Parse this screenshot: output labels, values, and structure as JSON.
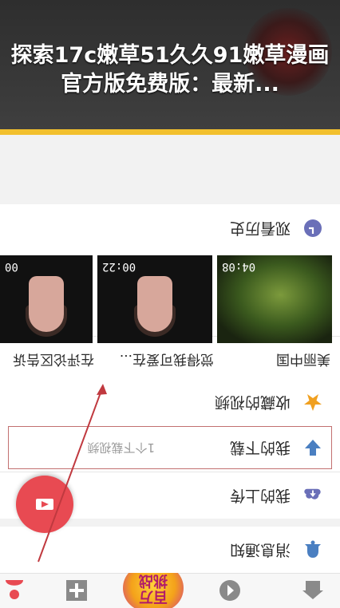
{
  "banner": {
    "title": "探索17c嫩草51久久91嫩草漫画官方版免费版：最新..."
  },
  "app": {
    "rows": {
      "messages": "消息通知",
      "uploads": "我的上传",
      "favorites": "收藏的视频",
      "downloads": "我的下载",
      "downloads_hint": "1个下载视频",
      "history": "观看历史"
    },
    "history_items": [
      {
        "caption": "美丽中国",
        "duration": "04:08"
      },
      {
        "caption": "觉得我可爱在...",
        "duration": "00:22"
      },
      {
        "caption": "在评论区告诉",
        "duration": "00"
      }
    ],
    "tab_promo": "百万\n挑战"
  },
  "colors": {
    "accent_yellow": "#f2c02e",
    "fab_red": "#e84a52",
    "icon_blue": "#4a7fc1",
    "icon_star": "#f0a020",
    "icon_history": "#6a6fb8"
  },
  "icons": [
    "home-icon",
    "back-icon",
    "plus-icon",
    "bell-icon",
    "cloud-upload-icon",
    "star-icon",
    "download-icon",
    "clock-icon",
    "camera-icon"
  ]
}
